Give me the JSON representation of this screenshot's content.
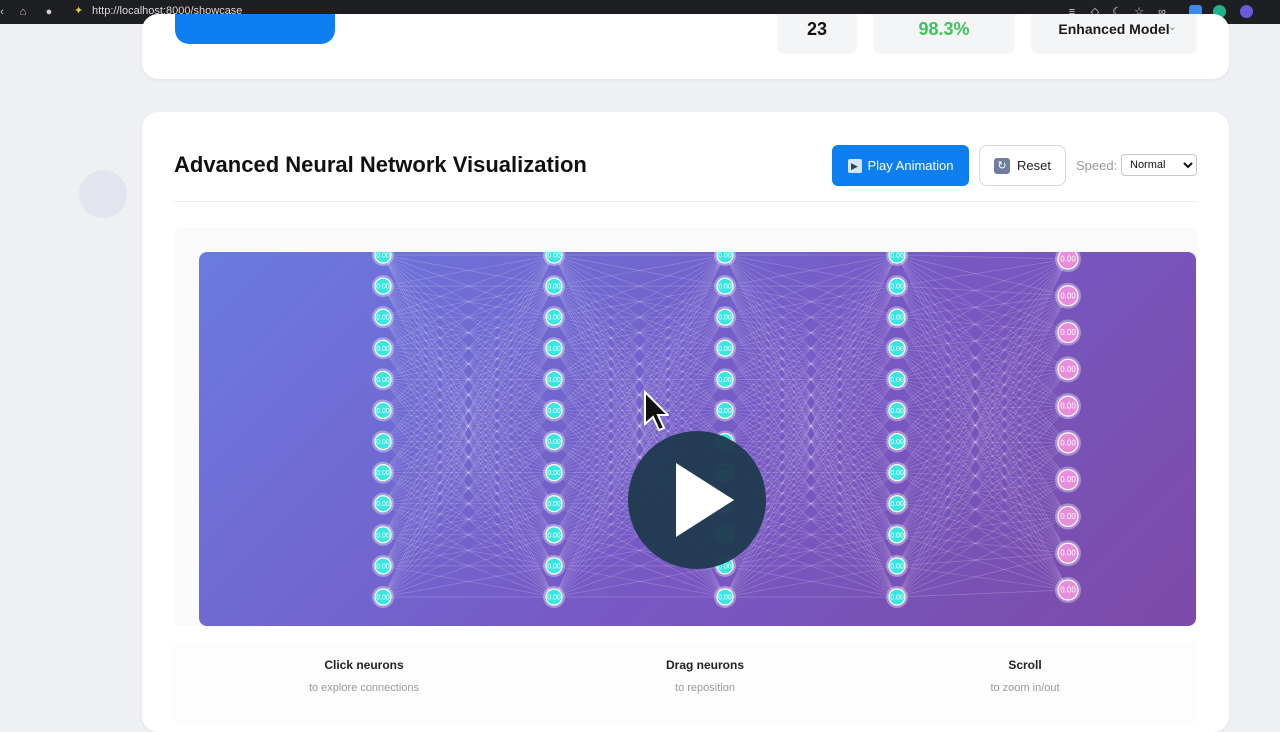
{
  "browser": {
    "url": "http://localhost:8000/showcase"
  },
  "stats": {
    "count": "23",
    "accuracy": "98.3%",
    "model": "Enhanced Model"
  },
  "section": {
    "title": "Advanced Neural Network Visualization",
    "play_label": "Play Animation",
    "reset_label": "Reset",
    "speed_label": "Speed:",
    "speed_value": "Normal",
    "speed_options": [
      "Normal"
    ]
  },
  "network": {
    "layers": [
      12,
      12,
      12,
      12,
      10
    ],
    "neuron_label": "0.00",
    "input_color": "#39e6e0",
    "output_color": "#e68ddc",
    "background_start": "#6a7be0",
    "background_end": "#7c4aa8"
  },
  "hints": [
    {
      "title": "Click neurons",
      "subtitle": "to explore connections"
    },
    {
      "title": "Drag neurons",
      "subtitle": "to reposition"
    },
    {
      "title": "Scroll",
      "subtitle": "to zoom in/out"
    }
  ],
  "icons": {
    "play": "play-icon",
    "reset": "reset-icon",
    "video_overlay": "play-overlay-icon",
    "cursor": "cursor-icon"
  }
}
